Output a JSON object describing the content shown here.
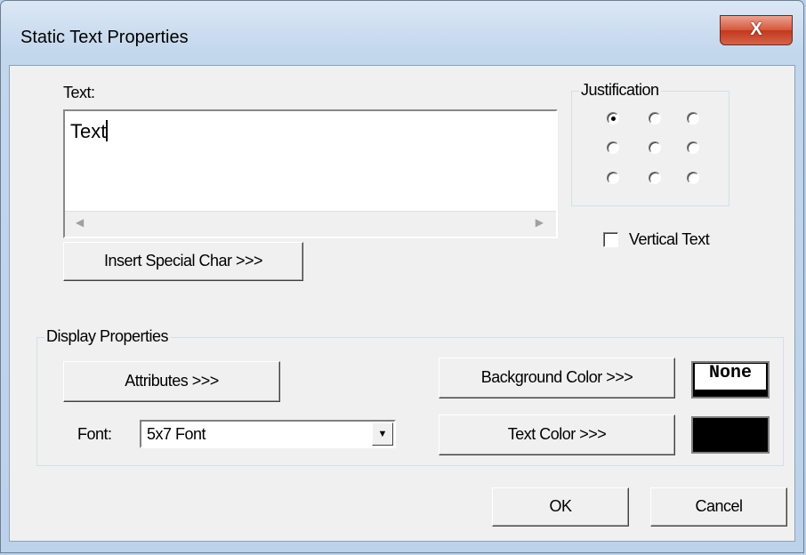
{
  "window": {
    "title": "Static Text Properties",
    "close_glyph": "X"
  },
  "text_section": {
    "label": "Text:",
    "value": "Text",
    "scroll_left": "◀",
    "scroll_right": "▶"
  },
  "insert_special_char_label": "Insert Special Char >>>",
  "justification": {
    "legend": "Justification",
    "selected_index": 0
  },
  "vertical_text": {
    "label": "Vertical Text",
    "checked": false
  },
  "display_properties": {
    "legend": "Display Properties",
    "attributes_label": "Attributes >>>",
    "font_label": "Font:",
    "font_value": "5x7 Font",
    "background_color_label": "Background Color >>>",
    "background_swatch_text": "None",
    "text_color_label": "Text Color >>>",
    "text_color": "#000000"
  },
  "buttons": {
    "ok": "OK",
    "cancel": "Cancel"
  }
}
